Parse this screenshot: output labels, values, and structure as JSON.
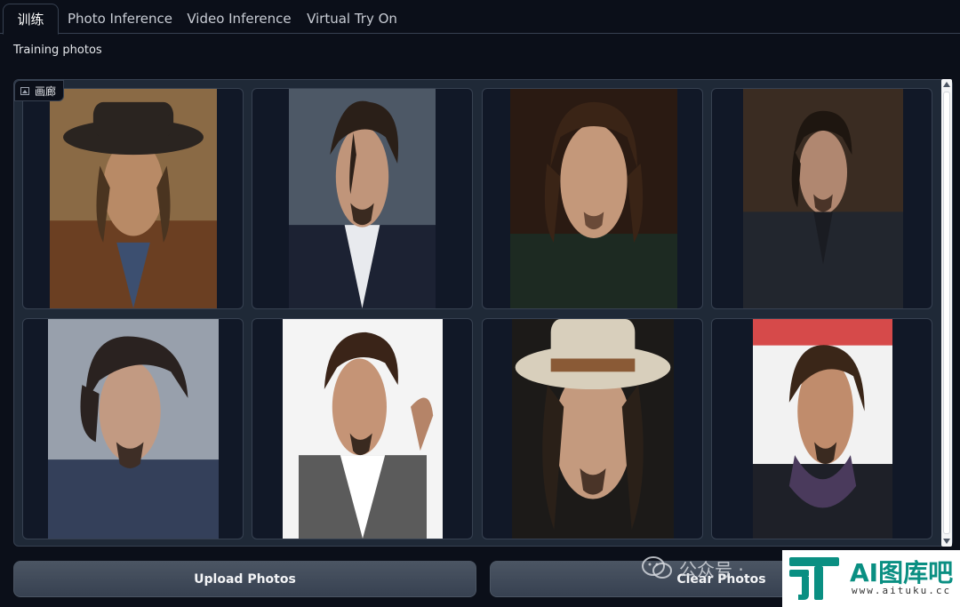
{
  "tabs": [
    {
      "label": "训练",
      "active": true
    },
    {
      "label": "Photo Inference",
      "active": false
    },
    {
      "label": "Video Inference",
      "active": false
    },
    {
      "label": "Virtual Try On",
      "active": false
    }
  ],
  "training": {
    "label": "Training photos",
    "gallery_badge": "画廊"
  },
  "buttons": {
    "upload": "Upload Photos",
    "clear": "Clear Photos"
  },
  "watermark": {
    "wechat_text": "公众号 ·",
    "logo_title": "AI图库吧",
    "logo_url": "www.aituku.cc"
  },
  "colors": {
    "background": "#0b0f19",
    "panel": "#1f2937",
    "border": "#374151",
    "button": "#4b5563",
    "logo_accent": "#0a8f82"
  }
}
